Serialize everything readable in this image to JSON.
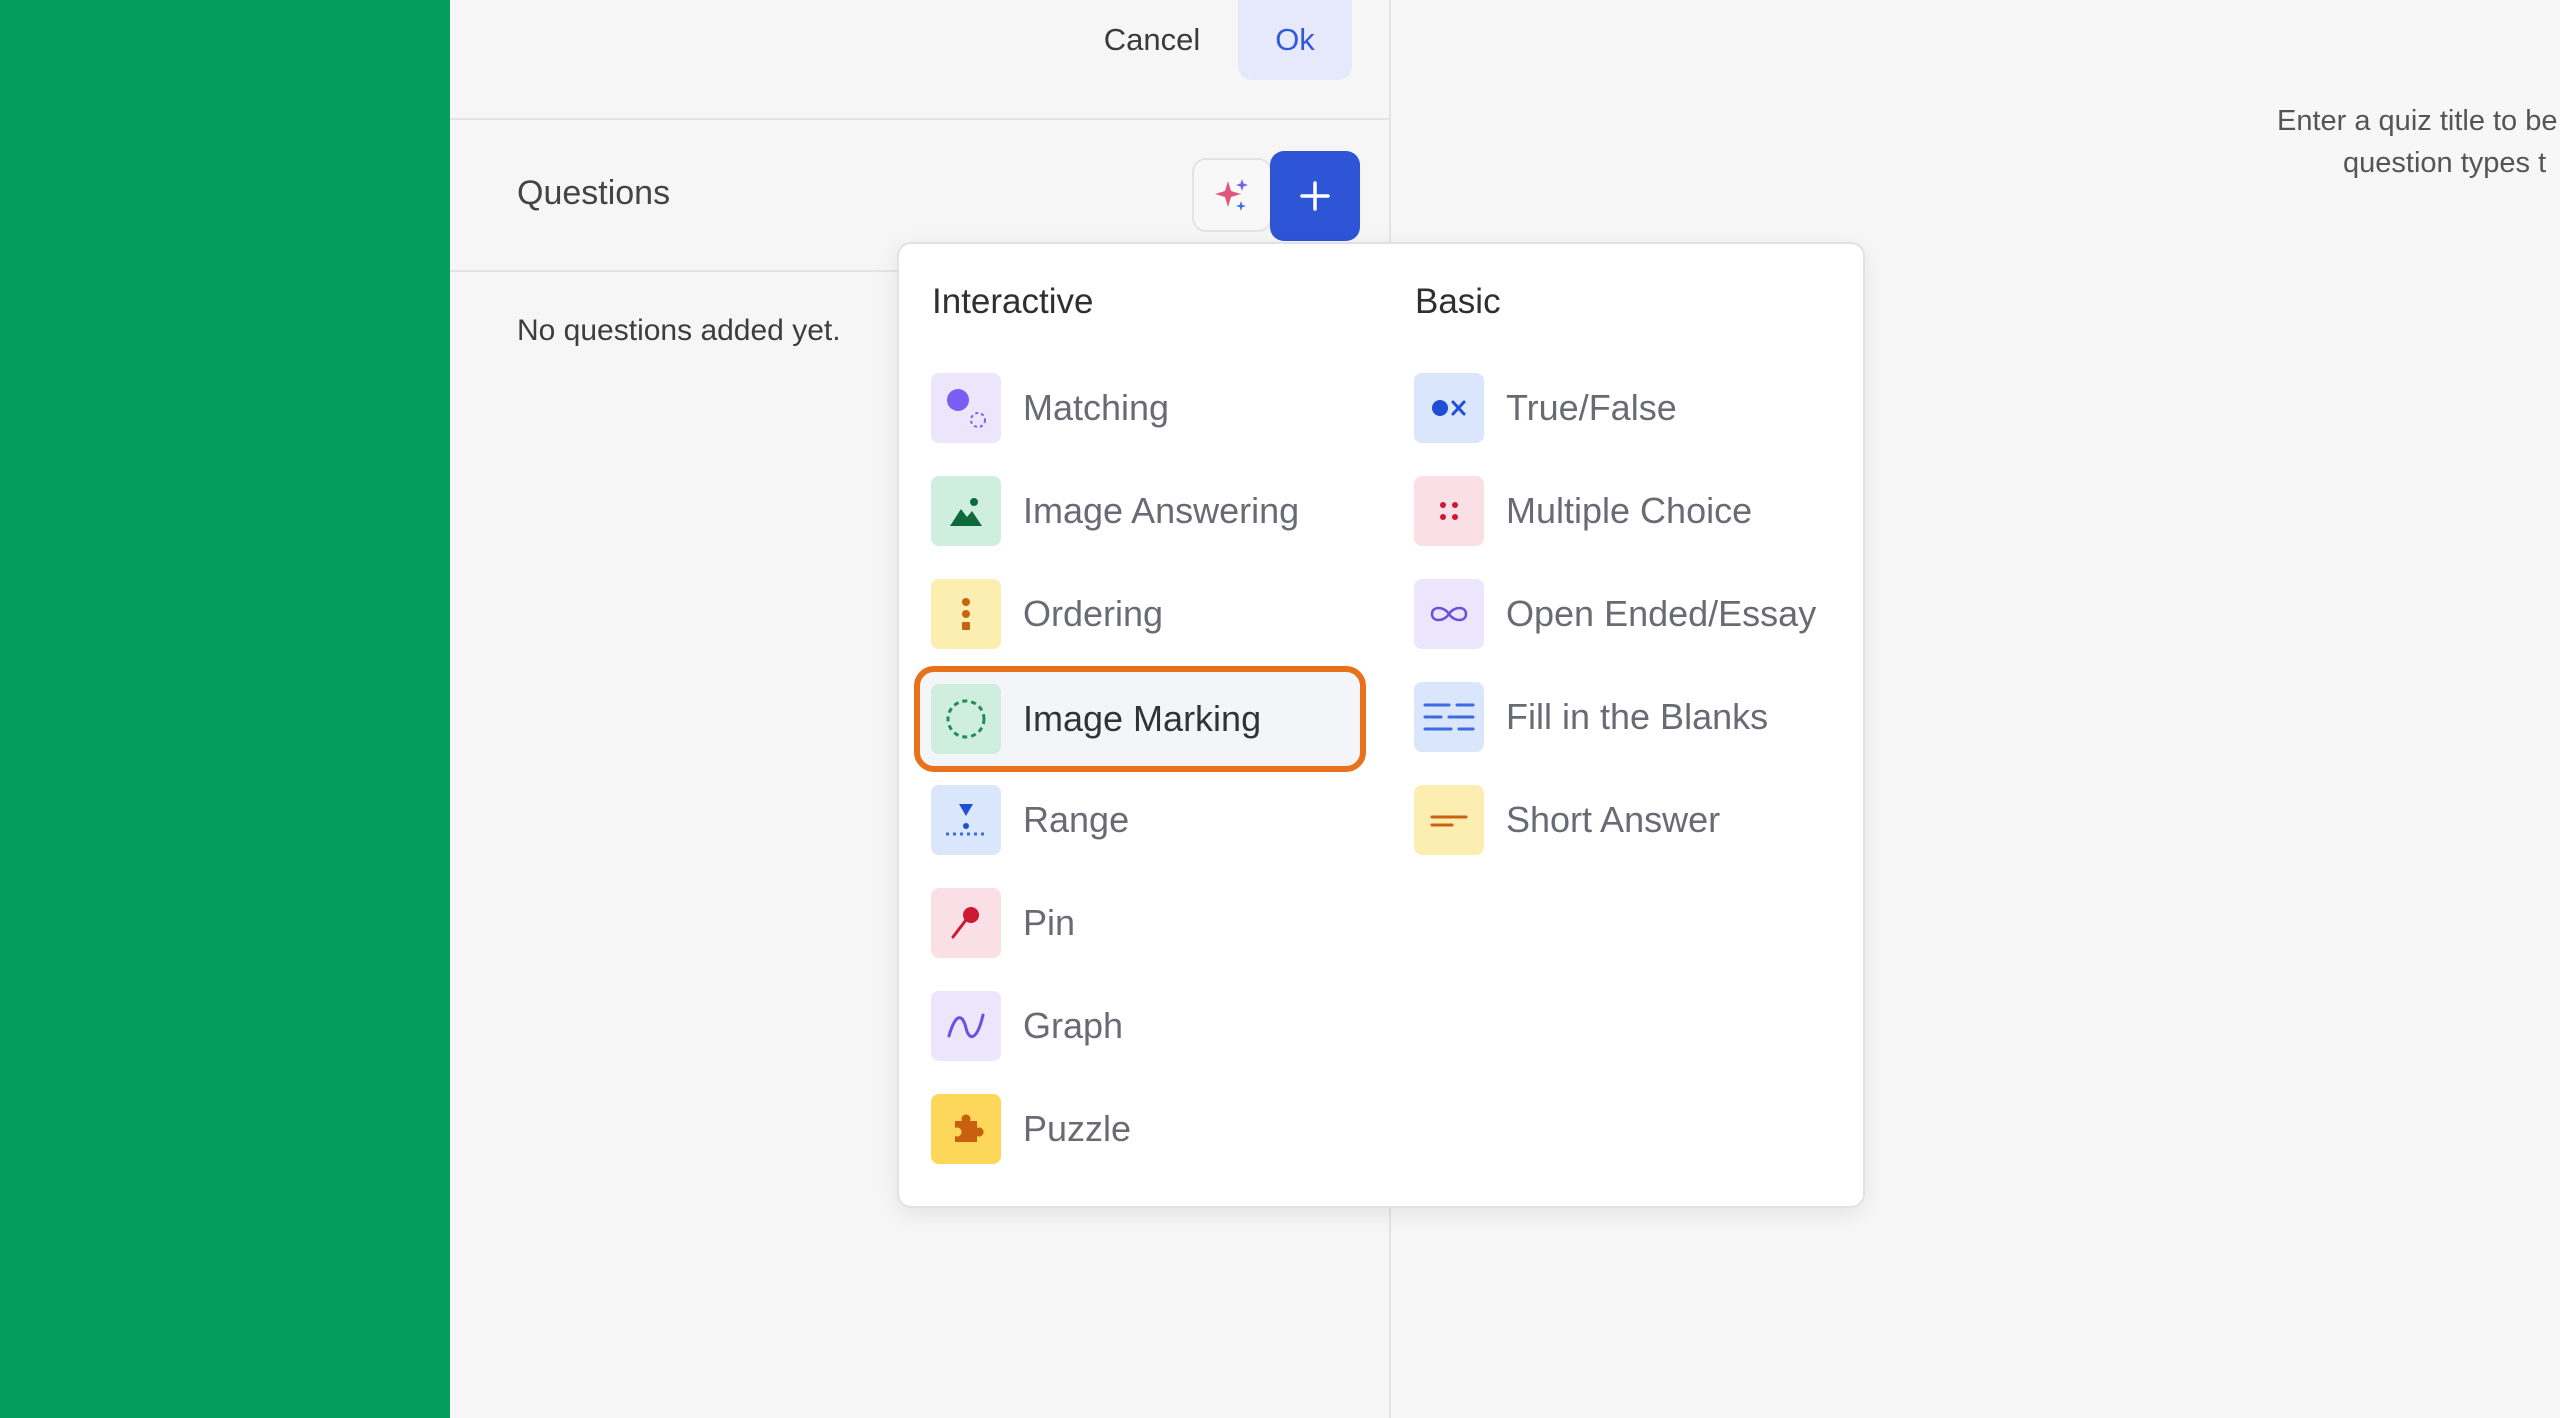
{
  "header": {
    "cancel_label": "Cancel",
    "ok_label": "Ok"
  },
  "questions": {
    "title": "Questions",
    "empty_message": "No questions added yet."
  },
  "hint": {
    "line1": "Enter a quiz title to be",
    "line2": "question types t"
  },
  "menu": {
    "interactive_heading": "Interactive",
    "basic_heading": "Basic",
    "interactive": [
      {
        "label": "Matching",
        "icon": "matching-icon"
      },
      {
        "label": "Image Answering",
        "icon": "mountain-icon"
      },
      {
        "label": "Ordering",
        "icon": "ordering-icon"
      },
      {
        "label": "Image Marking",
        "icon": "dashed-circle-icon",
        "selected": true
      },
      {
        "label": "Range",
        "icon": "range-icon"
      },
      {
        "label": "Pin",
        "icon": "pin-icon"
      },
      {
        "label": "Graph",
        "icon": "graph-icon"
      },
      {
        "label": "Puzzle",
        "icon": "puzzle-icon"
      }
    ],
    "basic": [
      {
        "label": "True/False",
        "icon": "true-false-icon"
      },
      {
        "label": "Multiple Choice",
        "icon": "multiple-choice-icon"
      },
      {
        "label": "Open Ended/Essay",
        "icon": "infinity-icon"
      },
      {
        "label": "Fill in the Blanks",
        "icon": "fill-blanks-icon"
      },
      {
        "label": "Short Answer",
        "icon": "short-answer-icon"
      }
    ]
  },
  "colors": {
    "sidebar": "#049e5c",
    "primary": "#2d55d6",
    "highlight": "#e8721c"
  }
}
